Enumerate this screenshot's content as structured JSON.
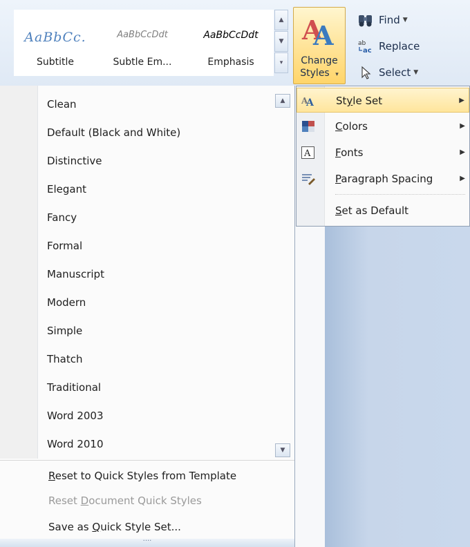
{
  "ribbon": {
    "gallery": [
      {
        "preview": "AaBbCc.",
        "caption": "Subtitle"
      },
      {
        "preview": "AaBbCcDdt",
        "caption": "Subtle Em..."
      },
      {
        "preview": "AaBbCcDdt",
        "caption": "Emphasis"
      }
    ],
    "change_styles": {
      "line1": "Change",
      "line2": "Styles"
    },
    "editing": {
      "find": "Find",
      "replace": "Replace",
      "select": "Select"
    }
  },
  "style_set_list": {
    "items": [
      "Clean",
      "Default (Black and White)",
      "Distinctive",
      "Elegant",
      "Fancy",
      "Formal",
      "Manuscript",
      "Modern",
      "Simple",
      "Thatch",
      "Traditional",
      "Word 2003",
      "Word 2010"
    ],
    "actions": {
      "reset_template": {
        "u": "R",
        "rest": "eset to Quick Styles from Template"
      },
      "reset_document": {
        "pre": "Reset ",
        "u": "D",
        "rest": "ocument Quick Styles"
      },
      "save_as": {
        "pre": "Save as ",
        "u": "Q",
        "rest": "uick Style Set..."
      }
    }
  },
  "change_styles_menu": {
    "style_set": {
      "pre": "St",
      "u": "y",
      "rest": "le Set"
    },
    "colors": {
      "u": "C",
      "rest": "olors"
    },
    "fonts": {
      "u": "F",
      "rest": "onts"
    },
    "paragraph_spacing": {
      "u": "P",
      "rest": "aragraph Spacing"
    },
    "set_default": {
      "u": "S",
      "rest": "et as Default"
    }
  }
}
